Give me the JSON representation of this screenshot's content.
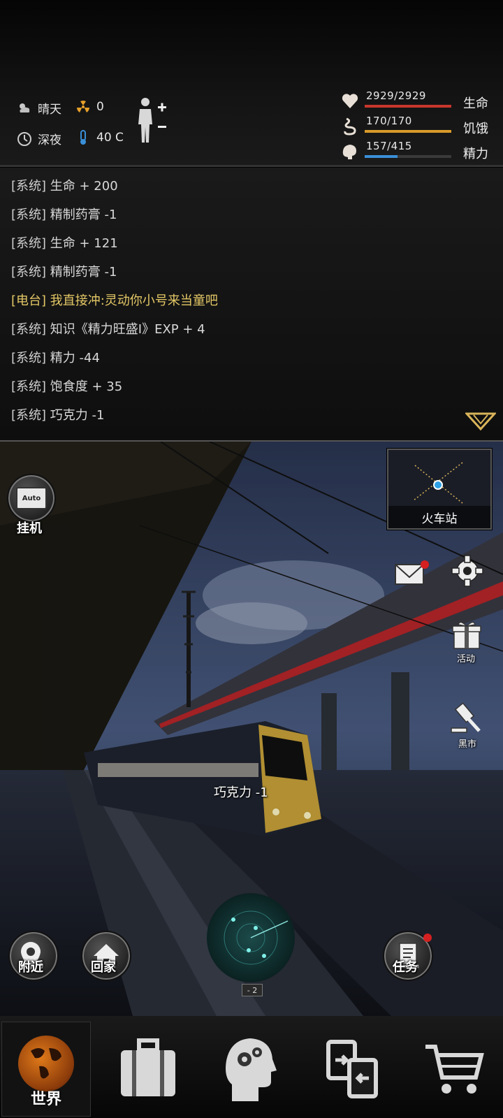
{
  "status": {
    "weather": "晴天",
    "radiation": "0",
    "time_of_day": "深夜",
    "temperature": "40 C"
  },
  "vitals": [
    {
      "label": "生命",
      "value": "2929/2929",
      "ratio": 1.0,
      "color": "#c8362c",
      "icon": "heart-icon"
    },
    {
      "label": "饥饿",
      "value": "170/170",
      "ratio": 1.0,
      "color": "#d89a2a",
      "icon": "stomach-icon"
    },
    {
      "label": "精力",
      "value": "157/415",
      "ratio": 0.378,
      "color": "#3a8fd8",
      "icon": "brain-icon"
    }
  ],
  "log": [
    {
      "tag": "[系统]",
      "text": "生命 + 200"
    },
    {
      "tag": "[系统]",
      "text": "精制药膏 -1"
    },
    {
      "tag": "[系统]",
      "text": "生命 + 121"
    },
    {
      "tag": "[系统]",
      "text": "精制药膏 -1"
    },
    {
      "tag": "[电台]",
      "text": "我直接冲:灵动你小号来当童吧"
    },
    {
      "tag": "[系统]",
      "text": "知识《精力旺盛Ⅰ》EXP + 4"
    },
    {
      "tag": "[系统]",
      "text": "精力 -44"
    },
    {
      "tag": "[系统]",
      "text": "饱食度 + 35"
    },
    {
      "tag": "[系统]",
      "text": "巧克力 -1"
    }
  ],
  "scene": {
    "location": "火车站",
    "float_text": "巧克力 -1",
    "radar_level": "- 2"
  },
  "buttons": {
    "idle": "挂机",
    "idle_badge": "Auto",
    "nearby": "附近",
    "home": "回家",
    "tasks": "任务",
    "events": "活动",
    "black_market": "黑市"
  },
  "nav": {
    "world": "世界"
  }
}
